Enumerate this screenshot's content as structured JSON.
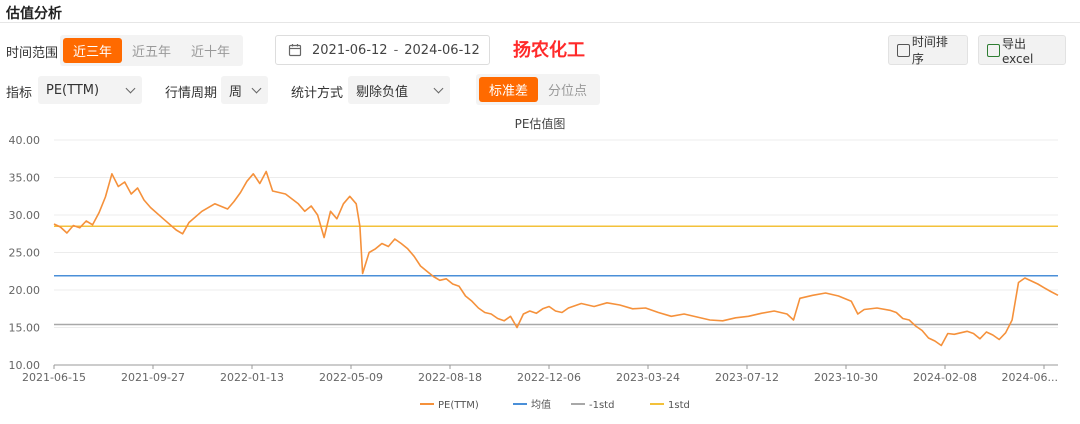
{
  "section": {
    "title": "估值分析"
  },
  "range": {
    "label": "时间范围",
    "options": [
      "近三年",
      "近五年",
      "近十年"
    ],
    "active": 0
  },
  "dates": {
    "start": "2021-06-12",
    "separator": "-",
    "end": "2024-06-12"
  },
  "company": "扬农化工",
  "buttons": {
    "sort": "时间排序",
    "export": "导出excel"
  },
  "filters": {
    "metric_label": "指标",
    "metric_value": "PE(TTM)",
    "period_label": "行情周期",
    "period_value": "周",
    "stat_label": "统计方式",
    "stat_value": "剔除负值",
    "mode_options": [
      "标准差",
      "分位点"
    ],
    "mode_active": 0
  },
  "colors": {
    "accent": "#ff6a00",
    "pe": "#f5913b",
    "mean": "#4a8fd8",
    "minus1": "#a8a8a8",
    "plus1": "#f3c13a"
  },
  "chart_data": {
    "type": "line",
    "title": "PE估值图",
    "ylim": [
      10,
      40
    ],
    "yticks": [
      "40.00",
      "35.00",
      "30.00",
      "25.00",
      "20.00",
      "15.00",
      "10.00"
    ],
    "xticks": [
      "2021-06-15",
      "2021-09-27",
      "2022-01-13",
      "2022-05-09",
      "2022-08-18",
      "2022-12-06",
      "2023-03-24",
      "2023-07-12",
      "2023-10-30",
      "2024-02-08",
      "2024-06..."
    ],
    "x_range": [
      "2021-06-15",
      "2024-06-12"
    ],
    "grid": true,
    "legend_position": "bottom",
    "series": [
      {
        "name": "PE(TTM)",
        "points": [
          [
            "2021-06-15",
            28.8
          ],
          [
            "2021-06-22",
            28.4
          ],
          [
            "2021-06-29",
            27.6
          ],
          [
            "2021-07-06",
            28.6
          ],
          [
            "2021-07-13",
            28.3
          ],
          [
            "2021-07-20",
            29.2
          ],
          [
            "2021-07-27",
            28.7
          ],
          [
            "2021-08-03",
            30.3
          ],
          [
            "2021-08-10",
            32.4
          ],
          [
            "2021-08-17",
            35.5
          ],
          [
            "2021-08-24",
            33.8
          ],
          [
            "2021-08-31",
            34.4
          ],
          [
            "2021-09-07",
            32.8
          ],
          [
            "2021-09-14",
            33.6
          ],
          [
            "2021-09-21",
            32.0
          ],
          [
            "2021-09-28",
            31.0
          ],
          [
            "2021-10-12",
            29.5
          ],
          [
            "2021-10-26",
            28.0
          ],
          [
            "2021-11-02",
            27.5
          ],
          [
            "2021-11-09",
            29.0
          ],
          [
            "2021-11-23",
            30.5
          ],
          [
            "2021-12-07",
            31.5
          ],
          [
            "2021-12-21",
            30.8
          ],
          [
            "2021-12-28",
            31.8
          ],
          [
            "2022-01-04",
            33.0
          ],
          [
            "2022-01-11",
            34.5
          ],
          [
            "2022-01-18",
            35.5
          ],
          [
            "2022-01-25",
            34.2
          ],
          [
            "2022-02-01",
            35.8
          ],
          [
            "2022-02-08",
            33.2
          ],
          [
            "2022-02-22",
            32.8
          ],
          [
            "2022-03-08",
            31.5
          ],
          [
            "2022-03-15",
            30.5
          ],
          [
            "2022-03-22",
            31.2
          ],
          [
            "2022-03-29",
            30.0
          ],
          [
            "2022-04-05",
            27.0
          ],
          [
            "2022-04-12",
            30.5
          ],
          [
            "2022-04-19",
            29.5
          ],
          [
            "2022-04-26",
            31.5
          ],
          [
            "2022-05-03",
            32.5
          ],
          [
            "2022-05-10",
            31.5
          ],
          [
            "2022-05-14",
            28.5
          ],
          [
            "2022-05-17",
            22.2
          ],
          [
            "2022-05-24",
            25.0
          ],
          [
            "2022-05-31",
            25.5
          ],
          [
            "2022-06-07",
            26.2
          ],
          [
            "2022-06-14",
            25.8
          ],
          [
            "2022-06-21",
            26.8
          ],
          [
            "2022-06-28",
            26.2
          ],
          [
            "2022-07-05",
            25.5
          ],
          [
            "2022-07-12",
            24.5
          ],
          [
            "2022-07-19",
            23.2
          ],
          [
            "2022-07-26",
            22.5
          ],
          [
            "2022-08-02",
            21.8
          ],
          [
            "2022-08-09",
            21.3
          ],
          [
            "2022-08-16",
            21.5
          ],
          [
            "2022-08-23",
            20.8
          ],
          [
            "2022-08-30",
            20.5
          ],
          [
            "2022-09-06",
            19.2
          ],
          [
            "2022-09-13",
            18.5
          ],
          [
            "2022-09-20",
            17.6
          ],
          [
            "2022-09-27",
            17.0
          ],
          [
            "2022-10-04",
            16.8
          ],
          [
            "2022-10-11",
            16.2
          ],
          [
            "2022-10-18",
            15.9
          ],
          [
            "2022-10-25",
            16.5
          ],
          [
            "2022-11-01",
            15.0
          ],
          [
            "2022-11-08",
            16.8
          ],
          [
            "2022-11-15",
            17.2
          ],
          [
            "2022-11-22",
            16.9
          ],
          [
            "2022-11-29",
            17.5
          ],
          [
            "2022-12-06",
            17.8
          ],
          [
            "2022-12-13",
            17.2
          ],
          [
            "2022-12-20",
            17.0
          ],
          [
            "2022-12-27",
            17.6
          ],
          [
            "2023-01-10",
            18.2
          ],
          [
            "2023-01-24",
            17.8
          ],
          [
            "2023-02-07",
            18.3
          ],
          [
            "2023-02-21",
            18.0
          ],
          [
            "2023-03-07",
            17.5
          ],
          [
            "2023-03-21",
            17.6
          ],
          [
            "2023-04-04",
            17.0
          ],
          [
            "2023-04-18",
            16.5
          ],
          [
            "2023-05-02",
            16.8
          ],
          [
            "2023-05-16",
            16.4
          ],
          [
            "2023-05-30",
            16.0
          ],
          [
            "2023-06-13",
            15.9
          ],
          [
            "2023-06-27",
            16.3
          ],
          [
            "2023-07-11",
            16.5
          ],
          [
            "2023-07-25",
            16.9
          ],
          [
            "2023-08-08",
            17.2
          ],
          [
            "2023-08-22",
            16.8
          ],
          [
            "2023-08-29",
            16.0
          ],
          [
            "2023-09-05",
            18.9
          ],
          [
            "2023-09-19",
            19.3
          ],
          [
            "2023-10-03",
            19.6
          ],
          [
            "2023-10-17",
            19.2
          ],
          [
            "2023-10-31",
            18.5
          ],
          [
            "2023-11-07",
            16.8
          ],
          [
            "2023-11-14",
            17.4
          ],
          [
            "2023-11-28",
            17.6
          ],
          [
            "2023-12-12",
            17.3
          ],
          [
            "2023-12-19",
            17.0
          ],
          [
            "2023-12-26",
            16.2
          ],
          [
            "2024-01-02",
            16.0
          ],
          [
            "2024-01-09",
            15.2
          ],
          [
            "2024-01-16",
            14.6
          ],
          [
            "2024-01-23",
            13.6
          ],
          [
            "2024-01-30",
            13.2
          ],
          [
            "2024-02-06",
            12.6
          ],
          [
            "2024-02-13",
            14.2
          ],
          [
            "2024-02-20",
            14.1
          ],
          [
            "2024-02-27",
            14.3
          ],
          [
            "2024-03-05",
            14.5
          ],
          [
            "2024-03-12",
            14.2
          ],
          [
            "2024-03-19",
            13.5
          ],
          [
            "2024-03-26",
            14.4
          ],
          [
            "2024-04-02",
            14.0
          ],
          [
            "2024-04-09",
            13.4
          ],
          [
            "2024-04-16",
            14.3
          ],
          [
            "2024-04-23",
            16.0
          ],
          [
            "2024-04-30",
            21.0
          ],
          [
            "2024-05-07",
            21.6
          ],
          [
            "2024-05-14",
            21.2
          ],
          [
            "2024-05-21",
            20.8
          ],
          [
            "2024-05-28",
            20.3
          ],
          [
            "2024-06-04",
            19.8
          ],
          [
            "2024-06-12",
            19.3
          ]
        ]
      },
      {
        "name": "均值",
        "value": 21.9
      },
      {
        "name": "-1std",
        "value": 15.4
      },
      {
        "name": "1std",
        "value": 28.5
      }
    ]
  }
}
